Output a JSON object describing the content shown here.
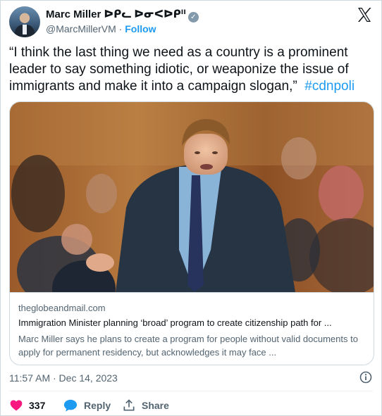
{
  "author": {
    "name": "Marc Miller ᐅᑭᓚ ᐅᓂᐸᐅᑭᐦ",
    "handle": "@MarcMillerVM",
    "separator": "·",
    "follow_label": "Follow"
  },
  "tweet": {
    "text": "“I think the last thing we need as a country is a prominent leader to say something idiotic, or weaponize the issue of immigrants and make it into a campaign slogan,”",
    "hashtag": "#cdnpoli"
  },
  "link_card": {
    "domain": "theglobeandmail.com",
    "title": "Immigration Minister planning ‘broad’ program to create citizenship path for ...",
    "description": "Marc Miller says he plans to create a program for people without valid documents to apply for permanent residency, but acknowledges it may face ..."
  },
  "timestamp": "11:57 AM · Dec 14, 2023",
  "actions": {
    "like_count": "337",
    "reply_label": "Reply",
    "share_label": "Share"
  },
  "icons": [
    "x-logo-icon",
    "verified-badge-icon",
    "info-icon",
    "heart-icon",
    "reply-bubble-icon",
    "share-icon"
  ],
  "colors": {
    "accent": "#1d9bf0",
    "like": "#f91880",
    "muted": "#536471",
    "text": "#0f1419"
  }
}
